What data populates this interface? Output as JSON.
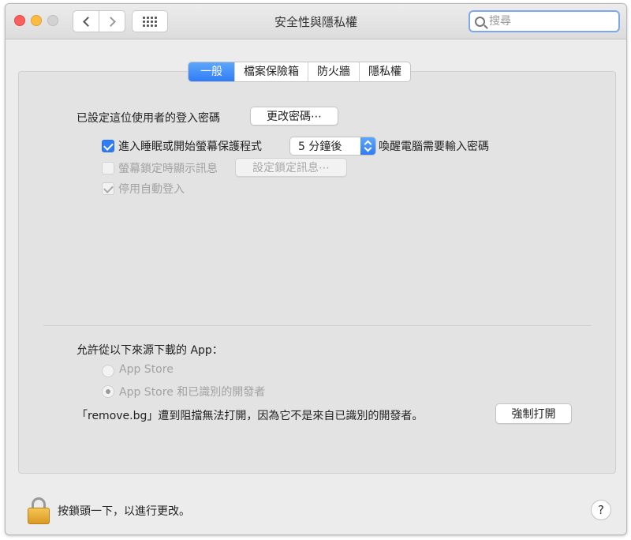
{
  "window": {
    "title": "安全性與隱私權"
  },
  "search": {
    "placeholder": "搜尋"
  },
  "tabs": [
    {
      "label": "一般",
      "active": true
    },
    {
      "label": "檔案保險箱",
      "active": false
    },
    {
      "label": "防火牆",
      "active": false
    },
    {
      "label": "隱私權",
      "active": false
    }
  ],
  "general": {
    "password_label": "已設定這位使用者的登入密碼",
    "change_password_button": "更改密碼⋯",
    "require_password": {
      "checkbox_label": "進入睡眠或開始螢幕保護程式",
      "checked": true,
      "delay_value": "5 分鐘後",
      "suffix": "喚醒電腦需要輸入密碼"
    },
    "lock_message": {
      "checkbox_label": "螢幕鎖定時顯示訊息",
      "checked": false,
      "button": "設定鎖定訊息⋯"
    },
    "disable_auto_login": {
      "checkbox_label": "停用自動登入",
      "checked": true
    }
  },
  "downloads": {
    "heading": "允許從以下來源下載的 App：",
    "options": [
      {
        "label": "App Store",
        "selected": false
      },
      {
        "label": "App Store 和已識別的開發者",
        "selected": true
      }
    ],
    "blocked_message": "「remove.bg」遭到阻擋無法打開，因為它不是來自已識別的開發者。",
    "open_anyway_button": "強制打開"
  },
  "footer": {
    "lock_text": "按鎖頭一下，以進行更改。",
    "help_label": "?"
  },
  "colors": {
    "accent": "#2f7cf5",
    "window_bg": "#ececec",
    "panel_bg": "#e3e3e3"
  }
}
